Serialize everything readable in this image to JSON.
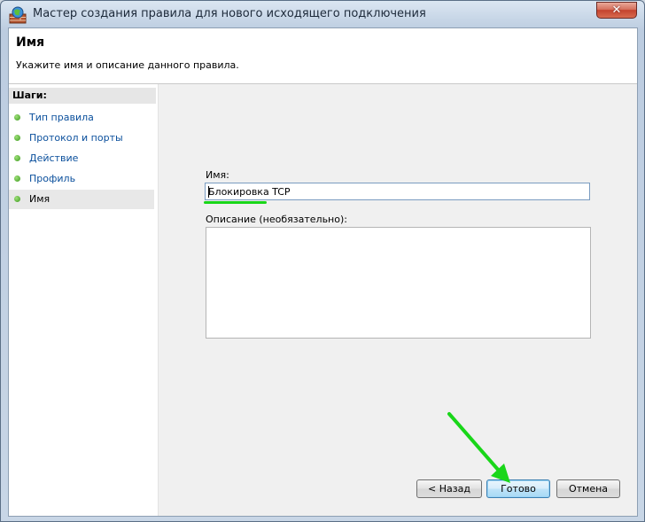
{
  "window": {
    "title": "Мастер создания правила для нового исходящего подключения",
    "close_glyph": "✕"
  },
  "header": {
    "title": "Имя",
    "description": "Укажите имя и описание данного правила."
  },
  "steps": {
    "heading": "Шаги:",
    "items": [
      {
        "label": "Тип правила"
      },
      {
        "label": "Протокол и порты"
      },
      {
        "label": "Действие"
      },
      {
        "label": "Профиль"
      },
      {
        "label": "Имя"
      }
    ]
  },
  "form": {
    "name_label": "Имя:",
    "name_value": "Блокировка TCP",
    "description_label": "Описание (необязательно):",
    "description_value": ""
  },
  "buttons": {
    "back": "< Назад",
    "finish": "Готово",
    "cancel": "Отмена"
  },
  "colors": {
    "annotation": "#19d619",
    "step_dot": "#3c9a1d",
    "link": "#0a4f9c"
  }
}
